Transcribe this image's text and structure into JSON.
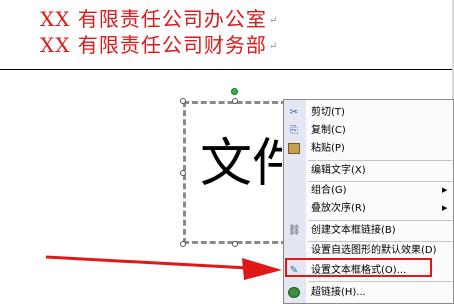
{
  "document": {
    "line1": "XX 有限责任公司办公室",
    "line2": "XX 有限责任公司财务部",
    "para_mark": "↵",
    "textbox_text": "文件"
  },
  "context_menu": {
    "items": [
      {
        "label": "剪切(T)",
        "icon": "scissors-icon",
        "icon_glyph": "✂"
      },
      {
        "label": "复制(C)",
        "icon": "copy-icon",
        "icon_glyph": "⎘"
      },
      {
        "label": "粘贴(P)",
        "icon": "paste-icon",
        "icon_glyph": "📋"
      },
      {
        "label": "编辑文字(X)",
        "icon": "",
        "icon_glyph": ""
      },
      {
        "label": "组合(G)",
        "icon": "",
        "icon_glyph": "",
        "submenu": "▶"
      },
      {
        "label": "叠放次序(R)",
        "icon": "",
        "icon_glyph": "",
        "submenu": "▶"
      },
      {
        "label": "创建文本框链接(B)",
        "icon": "chain-link-icon",
        "icon_glyph": "⛓"
      },
      {
        "label": "设置自选图形的默认效果(D)",
        "icon": "",
        "icon_glyph": ""
      },
      {
        "label": "设置文本框格式(O)...",
        "icon": "format-textbox-icon",
        "icon_glyph": "✎"
      },
      {
        "label": "超链接(H)...",
        "icon": "hyperlink-icon",
        "icon_glyph": "🌐"
      }
    ],
    "highlighted_item": "设置文本框格式(O)..."
  },
  "colors": {
    "red_text": "#e01818",
    "annotation_red": "#e01818",
    "menu_gutter": "#e2e7f2"
  }
}
